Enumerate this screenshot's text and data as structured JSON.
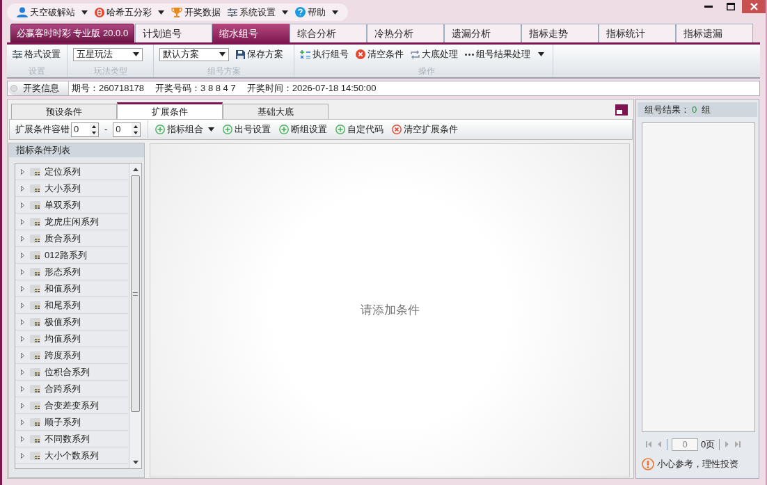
{
  "menu": [
    {
      "label": "天空破解站",
      "dropdown": true
    },
    {
      "label": "哈希五分彩",
      "dropdown": true
    },
    {
      "label": "开奖数据",
      "dropdown": false
    },
    {
      "label": "系统设置",
      "dropdown": true
    },
    {
      "label": "帮助",
      "dropdown": true
    }
  ],
  "app_title": "必赢客时时彩 专业版 20.0.0",
  "tabs": [
    {
      "label": "计划追号",
      "selected": false
    },
    {
      "label": "缩水组号",
      "selected": true
    },
    {
      "label": "综合分析",
      "selected": false
    },
    {
      "label": "冷热分析",
      "selected": false
    },
    {
      "label": "遗漏分析",
      "selected": false
    },
    {
      "label": "指标走势",
      "selected": false
    },
    {
      "label": "指标统计",
      "selected": false
    },
    {
      "label": "指标遗漏",
      "selected": false
    }
  ],
  "toolbar": [
    {
      "label": "设置",
      "items": [
        {
          "kind": "button",
          "label": "格式设置"
        }
      ]
    },
    {
      "label": "玩法类型",
      "items": [
        {
          "kind": "select",
          "label": "五星玩法"
        }
      ]
    },
    {
      "label": "组号方案",
      "items": [
        {
          "kind": "select",
          "label": "默认方案"
        },
        {
          "kind": "button",
          "label": "保存方案"
        }
      ]
    },
    {
      "label": "操作",
      "items": [
        {
          "kind": "button",
          "label": "执行组号"
        },
        {
          "kind": "button",
          "label": "清空条件"
        },
        {
          "kind": "button",
          "label": "大底处理"
        },
        {
          "kind": "button",
          "label": "组号结果处理",
          "dropdown": true
        }
      ]
    }
  ],
  "draw_info": {
    "label": "开奖信息",
    "fields": [
      "期号：260718178",
      "开奖号码：3 8 8 4 7",
      "开奖时间：2026-07-18 14:50:00"
    ]
  },
  "subtabs": [
    {
      "label": "预设条件",
      "selected": false
    },
    {
      "label": "扩展条件",
      "selected": true
    },
    {
      "label": "基础大底",
      "selected": false
    }
  ],
  "tolerance": {
    "label": "扩展条件容错",
    "min": "0",
    "separator": "-",
    "max": "0"
  },
  "actions": [
    {
      "label": "指标组合",
      "dropdown": true
    },
    {
      "label": "出号设置",
      "dropdown": false
    },
    {
      "label": "断组设置",
      "dropdown": false
    },
    {
      "label": "自定代码",
      "dropdown": false
    },
    {
      "label": "清空扩展条件",
      "dropdown": false
    }
  ],
  "indicator_list": {
    "title": "指标条件列表",
    "items": [
      "定位系列",
      "大小系列",
      "单双系列",
      "龙虎庄闲系列",
      "质合系列",
      "012路系列",
      "形态系列",
      "和值系列",
      "和尾系列",
      "极值系列",
      "均值系列",
      "跨度系列",
      "位积合系列",
      "合跨系列",
      "合变差变系列",
      "顺子系列",
      "不同数系列",
      "大小个数系列"
    ]
  },
  "empty_message": "请添加条件",
  "result": {
    "label": "组号结果：",
    "count": "0",
    "unit": "组",
    "page": "0",
    "total": "0页",
    "notice": "小心参考，理性投资"
  }
}
